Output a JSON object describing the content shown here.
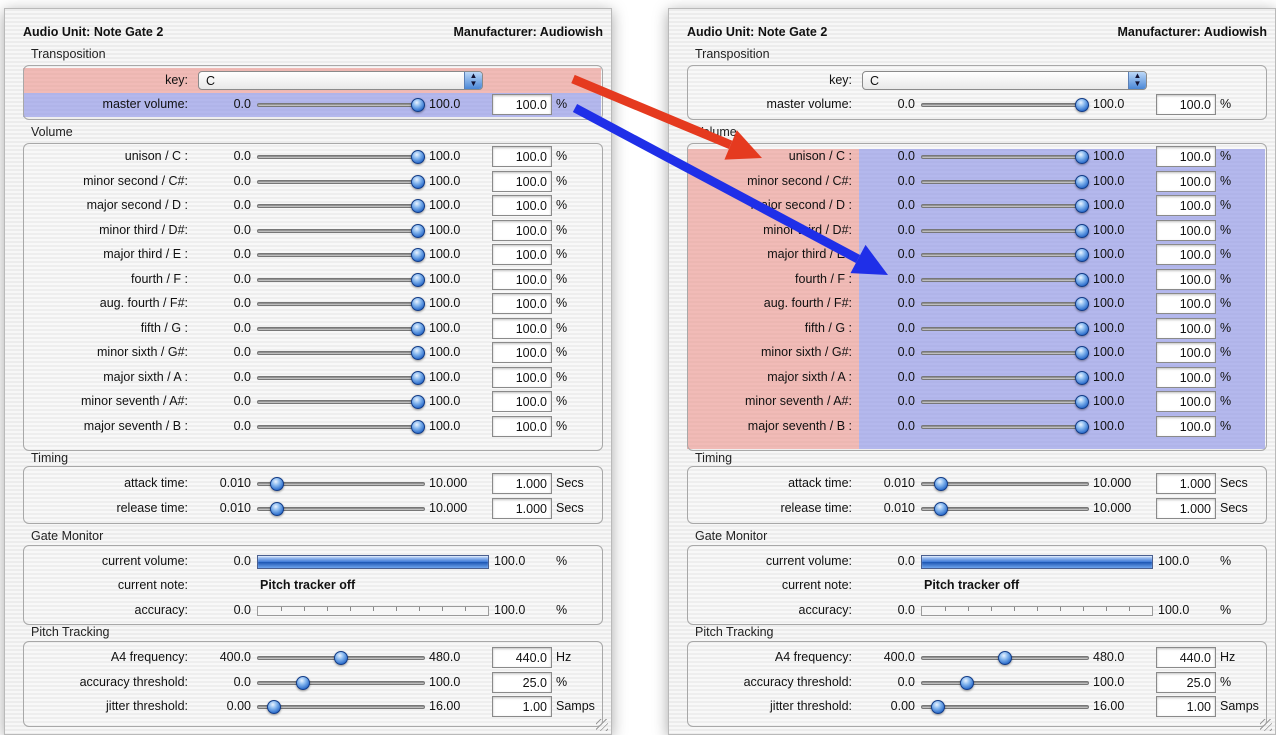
{
  "windows": {
    "title": "Audio Unit: Note Gate 2",
    "manufacturer": "Manufacturer: Audiowish"
  },
  "sections": {
    "transposition": "Transposition",
    "volume": "Volume",
    "timing": "Timing",
    "gate_monitor": "Gate Monitor",
    "pitch_tracking": "Pitch Tracking"
  },
  "transposition": {
    "key_label": "key:",
    "key_value": "C",
    "master": {
      "label": "master volume:",
      "min": "0.0",
      "max": "100.0",
      "value": "100.0",
      "unit": "%",
      "level": 1.0
    }
  },
  "volume_rows": [
    {
      "label": "unison / C  :",
      "min": "0.0",
      "max": "100.0",
      "value": "100.0",
      "unit": "%",
      "level": 1.0
    },
    {
      "label": "minor second / C#:",
      "min": "0.0",
      "max": "100.0",
      "value": "100.0",
      "unit": "%",
      "level": 1.0
    },
    {
      "label": "major second / D  :",
      "min": "0.0",
      "max": "100.0",
      "value": "100.0",
      "unit": "%",
      "level": 1.0
    },
    {
      "label": "minor third / D#:",
      "min": "0.0",
      "max": "100.0",
      "value": "100.0",
      "unit": "%",
      "level": 1.0
    },
    {
      "label": "major third / E  :",
      "min": "0.0",
      "max": "100.0",
      "value": "100.0",
      "unit": "%",
      "level": 1.0
    },
    {
      "label": "fourth / F  :",
      "min": "0.0",
      "max": "100.0",
      "value": "100.0",
      "unit": "%",
      "level": 1.0
    },
    {
      "label": "aug. fourth / F#:",
      "min": "0.0",
      "max": "100.0",
      "value": "100.0",
      "unit": "%",
      "level": 1.0
    },
    {
      "label": "fifth / G  :",
      "min": "0.0",
      "max": "100.0",
      "value": "100.0",
      "unit": "%",
      "level": 1.0
    },
    {
      "label": "minor sixth / G#:",
      "min": "0.0",
      "max": "100.0",
      "value": "100.0",
      "unit": "%",
      "level": 1.0
    },
    {
      "label": "major sixth / A  :",
      "min": "0.0",
      "max": "100.0",
      "value": "100.0",
      "unit": "%",
      "level": 1.0
    },
    {
      "label": "minor seventh / A#:",
      "min": "0.0",
      "max": "100.0",
      "value": "100.0",
      "unit": "%",
      "level": 1.0
    },
    {
      "label": "major seventh / B  :",
      "min": "0.0",
      "max": "100.0",
      "value": "100.0",
      "unit": "%",
      "level": 1.0
    }
  ],
  "timing_rows": [
    {
      "label": "attack time:",
      "min": "0.010",
      "max": "10.000",
      "value": "1.000",
      "unit": "Secs",
      "level": 0.1
    },
    {
      "label": "release time:",
      "min": "0.010",
      "max": "10.000",
      "value": "1.000",
      "unit": "Secs",
      "level": 0.1
    }
  ],
  "gate_monitor": {
    "current_volume": {
      "label": "current volume:",
      "min": "0.0",
      "max": "100.0",
      "unit": "%",
      "level": 1.0
    },
    "current_note": {
      "label": "current note:",
      "value": "Pitch tracker off"
    },
    "accuracy": {
      "label": "accuracy:",
      "min": "0.0",
      "max": "100.0",
      "unit": "%",
      "level": 0.0
    }
  },
  "pitch_rows": [
    {
      "label": "A4 frequency:",
      "min": "400.0",
      "max": "480.0",
      "value": "440.0",
      "unit": "Hz",
      "level": 0.5
    },
    {
      "label": "accuracy threshold:",
      "min": "0.0",
      "max": "100.0",
      "value": "25.0",
      "unit": "%",
      "level": 0.25
    },
    {
      "label": "jitter threshold:",
      "min": "0.00",
      "max": "16.00",
      "value": "1.00",
      "unit": "Samps",
      "level": 0.0625
    }
  ],
  "annotation_colors": {
    "red": "#e53a1f",
    "blue": "#1f2fe8"
  }
}
